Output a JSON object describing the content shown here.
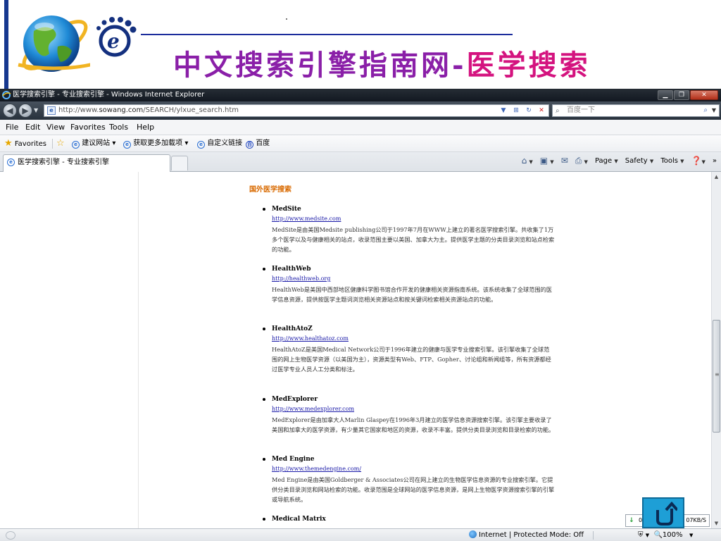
{
  "slide": {
    "title_part1": "中文搜索引擎指南网-",
    "title_part2": "医学搜索"
  },
  "browser": {
    "window_title": "医学搜索引擎 - 专业搜索引擎 - Windows Internet Explorer",
    "address": {
      "prefix": "http://www.",
      "domain": "sowang.com",
      "path": "/SEARCH/ylxue_search.htm"
    },
    "search_placeholder": "百度一下",
    "menu": [
      "File",
      "Edit",
      "View",
      "Favorites",
      "Tools",
      "Help"
    ],
    "favorites": {
      "label": "Favorites",
      "items": [
        "建议网站 ▾",
        "获取更多加载项 ▾",
        "自定义链接",
        "百度"
      ]
    },
    "tab_title": "医学搜索引擎 - 专业搜索引擎",
    "commands": {
      "page": "Page",
      "safety": "Safety",
      "tools": "Tools"
    },
    "status": {
      "zone": "Internet | Protected Mode: Off",
      "zoom": "100%"
    },
    "download": {
      "count": "0",
      "speed": "07KB/S"
    }
  },
  "page": {
    "section_title": "国外医学搜索",
    "entries": [
      {
        "name": "MedSite",
        "url": "http://www.medsite.com",
        "desc": "MedSite是由美国Medsite publishing公司于1997年7月在WWW上建立的著名医学搜索引擎。共收集了1万多个医学以及与健康相关的站点，收录范围主要以美国、加拿大为主。提供医学主题的分类目录浏览和站点检索的功能。"
      },
      {
        "name": "HealthWeb",
        "url": "http://healthweb.org",
        "desc": "HealthWeb是美国中西部地区健康科学图书馆合作开发的健康相关资源指南系统。该系统收集了全球范围的医学信息资源，提供按医学主题词浏览相关资源站点和按关键词检索相关资源站点的功能。"
      },
      {
        "name": "HealthAtoZ",
        "url": "http://www.healthatoz.com",
        "desc": "HealthAtoZ是美国Medical Network公司于1996年建立的健康与医学专业搜索引擎。该引擎收集了全球范围的网上生物医学资源（以美国为主），资源类型有Web、FTP、Gopher、讨论组和新闻组等，所有资源都经过医学专业人员人工分类和标注。"
      },
      {
        "name": "MedExplorer",
        "url": "http://www.medexplorer.com",
        "desc": "MedExplorer是由加拿大人Marlin Glaspey在1996年3月建立的医学信息资源搜索引擎。该引擎主要收录了美国和加拿大的医学资源，有少量其它国家和地区的资源，收录不丰富。提供分类目录浏览和目录检索的功能。"
      },
      {
        "name": "Med Engine",
        "url": "http://www.themedengine.com/",
        "desc": "Med Engine是由美国Goldberger & Associates公司在网上建立的生物医学信息资源的专业搜索引擎。它提供分类目录浏览和网站检索的功能。收录范围是全球网站的医学信息资源，是网上生物医学资源搜索引擎的引擎或导航系统。"
      },
      {
        "name": "Medical Matrix",
        "url": "",
        "desc": ""
      }
    ]
  },
  "colors": {
    "title_purple": "#8a1fa8",
    "title_magenta": "#d4137f",
    "section_orange": "#d96a00",
    "link_blue": "#1a1aa8",
    "return_button": "#1e9fd6"
  },
  "icons": [
    "globe-logo-icon",
    "e-logo-icon",
    "ie-icon",
    "back-icon",
    "forward-icon",
    "refresh-icon",
    "stop-icon",
    "search-icon",
    "star-icon",
    "home-icon",
    "feeds-icon",
    "mail-icon",
    "print-icon",
    "help-icon",
    "internet-globe-icon",
    "zoom-icon",
    "return-icon"
  ]
}
